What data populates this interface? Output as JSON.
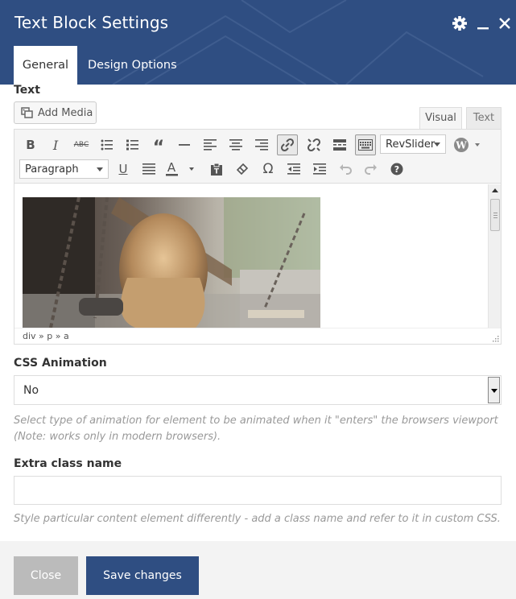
{
  "header": {
    "title": "Text Block Settings",
    "tabs": [
      {
        "label": "General",
        "active": true
      },
      {
        "label": "Design Options",
        "active": false
      }
    ],
    "icons": [
      "gear-icon",
      "minimize-icon",
      "close-icon"
    ]
  },
  "text_field": {
    "label": "Text",
    "add_media_label": "Add Media",
    "editor_tabs": [
      {
        "label": "Visual",
        "active": true
      },
      {
        "label": "Text",
        "active": false
      }
    ],
    "toolbar_row1": [
      "bold",
      "italic",
      "strikethrough",
      "bullet-list",
      "numbered-list",
      "blockquote",
      "horizontal-line",
      "align-left",
      "align-center",
      "align-right",
      "insert-link",
      "remove-link",
      "read-more",
      "toolbar-toggle",
      "revslider",
      "wordpress"
    ],
    "toolbar_row2": [
      "paragraph-format",
      "underline",
      "justify",
      "text-color",
      "paste-as-text",
      "clear-formatting",
      "special-character",
      "decrease-indent",
      "increase-indent",
      "undo",
      "redo",
      "help"
    ],
    "revslider_label": "RevSlider",
    "format_select_value": "Paragraph",
    "status_path": "div » p » a",
    "image_alt": "Girl on a swing"
  },
  "css_animation": {
    "label": "CSS Animation",
    "value": "No",
    "help": "Select type of animation for element to be animated when it \"enters\" the browsers viewport (Note: works only in modern browsers)."
  },
  "extra_class": {
    "label": "Extra class name",
    "value": "",
    "placeholder": "",
    "help": "Style particular content element differently - add a class name and refer to it in custom CSS."
  },
  "footer": {
    "close_label": "Close",
    "save_label": "Save changes"
  },
  "colors": {
    "header_bg": "#2f4e82",
    "save_button": "#2f4e82",
    "close_button": "#bbbbbb",
    "help_text": "#999999"
  }
}
